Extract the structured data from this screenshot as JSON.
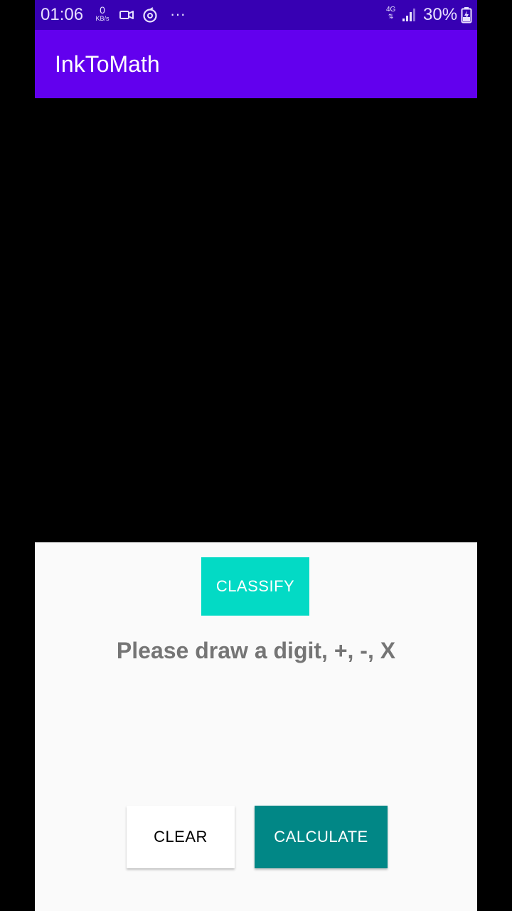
{
  "status_bar": {
    "time": "01:06",
    "data_rate_value": "0",
    "data_rate_unit": "KB/s",
    "more_indicator": "···",
    "network_type": "4G",
    "battery_percent": "30%",
    "color": "#3700b3"
  },
  "app_bar": {
    "title": "InkToMath",
    "color": "#6200ee"
  },
  "panel": {
    "classify_label": "CLASSIFY",
    "prompt": "Please draw a digit, +, -, X",
    "clear_label": "CLEAR",
    "calculate_label": "CALCULATE"
  },
  "colors": {
    "accent": "#03dac5",
    "teal_dark": "#018786",
    "canvas": "#000000"
  }
}
